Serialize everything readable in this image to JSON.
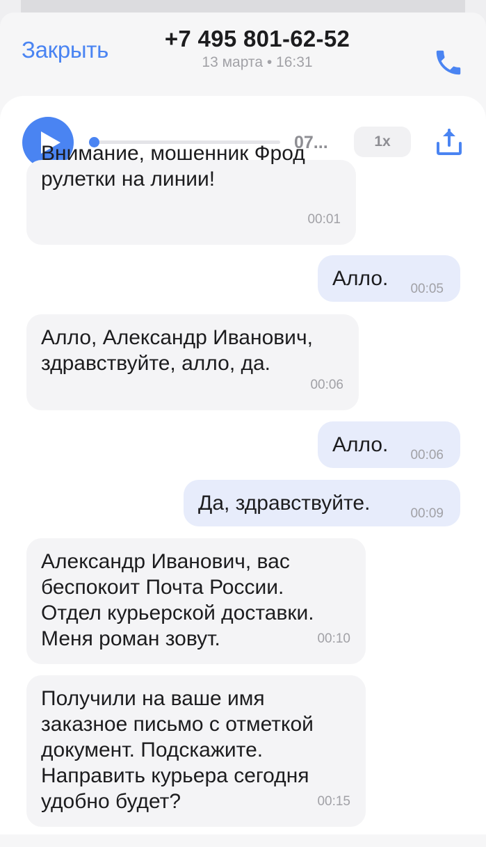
{
  "header": {
    "close_label": "Закрыть",
    "phone_number": "+7 495 801-62-52",
    "subtitle": "13 марта • 16:31",
    "call_icon": "phone-icon"
  },
  "player": {
    "play_icon": "play-icon",
    "progress": 0,
    "duration": "07...",
    "speed": "1x",
    "share_icon": "share-icon"
  },
  "colors": {
    "accent": "#4a84f2",
    "incoming_bubble": "#f4f4f6",
    "outgoing_bubble": "#e7ecfb"
  },
  "messages": [
    {
      "direction": "incoming",
      "text": "Внимание, мошенник Фрод\nрулетки на линии!",
      "time": "00:01"
    },
    {
      "direction": "outgoing",
      "text": "Алло.",
      "time": "00:05"
    },
    {
      "direction": "incoming",
      "text": "Алло, Александр Иванович,\nздравствуйте, алло, да.",
      "time": "00:06"
    },
    {
      "direction": "outgoing",
      "text": "Алло.",
      "time": "00:06"
    },
    {
      "direction": "outgoing",
      "text": "Да, здравствуйте.",
      "time": "00:09"
    },
    {
      "direction": "incoming",
      "text": "Александр Иванович, вас\nбеспокоит Почта России.\nОтдел курьерской доставки.\nМеня роман зовут.",
      "time": "00:10"
    },
    {
      "direction": "incoming",
      "text": "Получили на ваше имя\nзаказное письмо с отметкой\nдокумент. Подскажите.\nНаправить курьера сегодня\nудобно будет?",
      "time": "00:15"
    }
  ]
}
